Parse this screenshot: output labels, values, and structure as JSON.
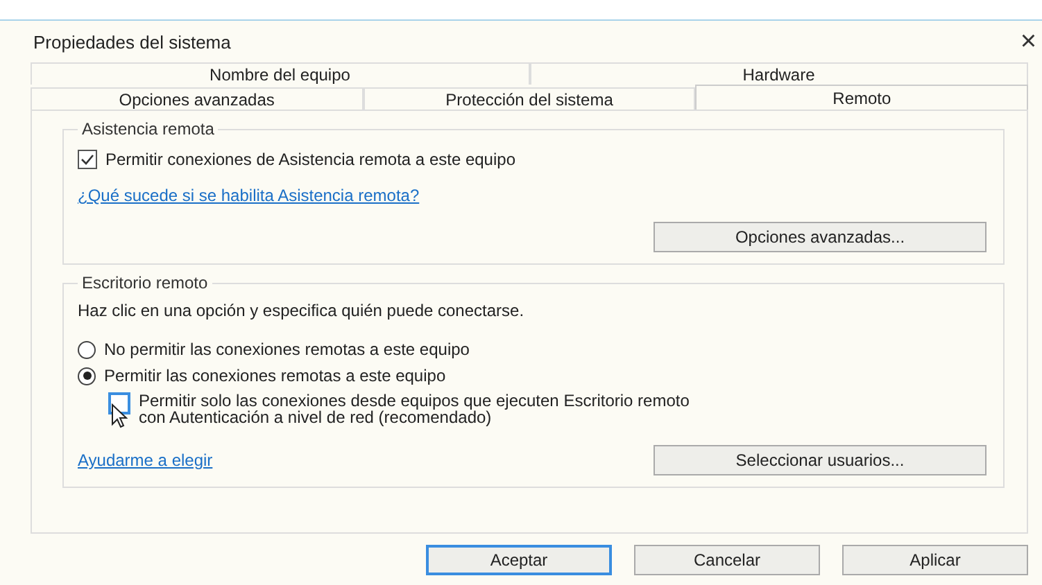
{
  "window": {
    "title": "Propiedades del sistema",
    "close": "×"
  },
  "tab_rows": [
    [
      {
        "label": "Nombre del equipo",
        "selected": false
      },
      {
        "label": "Hardware",
        "selected": false
      }
    ],
    [
      {
        "label": "Opciones avanzadas",
        "selected": false
      },
      {
        "label": "Protección del sistema",
        "selected": false
      },
      {
        "label": "Remoto",
        "selected": true
      }
    ]
  ],
  "remote_assistance": {
    "title": "Asistencia remota",
    "checkbox": {
      "label": "Permitir conexiones de Asistencia remota a este equipo",
      "checked": true
    },
    "link": "¿Qué sucede si se habilita Asistencia remota?",
    "button": "Opciones avanzadas..."
  },
  "remote_desktop": {
    "title": "Escritorio remoto",
    "description": "Haz clic en una opción y especifica quién puede conectarse.",
    "options": [
      {
        "label": "No permitir las conexiones remotas a este equipo",
        "selected": false
      },
      {
        "label": "Permitir las conexiones remotas a este equipo",
        "selected": true
      }
    ],
    "nla_checkbox": {
      "label": "Permitir solo las conexiones desde equipos que ejecuten Escritorio remoto con Autenticación a nivel de red (recomendado)",
      "checked": false
    },
    "link": "Ayudarme a elegir",
    "button": "Seleccionar usuarios..."
  },
  "buttons": [
    {
      "label": "Aceptar",
      "default": true
    },
    {
      "label": "Cancelar",
      "default": false
    },
    {
      "label": "Aplicar",
      "default": false
    }
  ]
}
